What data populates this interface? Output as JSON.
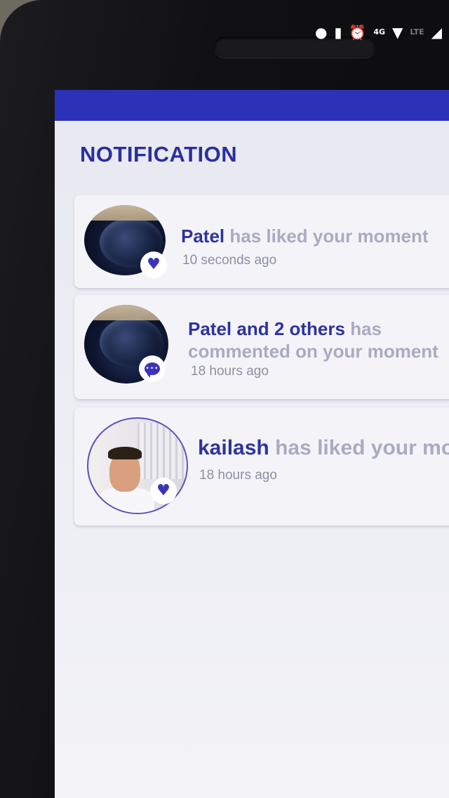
{
  "status_bar": {
    "icons": [
      "location-icon",
      "vibrate-icon",
      "alarm-icon",
      "call-4g-icon",
      "wifi-icon",
      "signal-icon"
    ],
    "network_label": "4G",
    "lte_label": "LTE",
    "color": "#2b32b8"
  },
  "header": {
    "title": "NOTIFICATION",
    "title_color": "#2a2f9e"
  },
  "notifications": [
    {
      "actor": "Patel",
      "action": " has liked your moment",
      "time": "10 seconds ago",
      "badge_icon": "heart-icon"
    },
    {
      "actor": "Patel and 2 others",
      "action": " has commented on your moment",
      "time": "18 hours ago",
      "badge_icon": "comment-icon"
    },
    {
      "actor": "kailash",
      "action": " has liked your moment",
      "time": "18 hours ago",
      "badge_icon": "heart-icon"
    }
  ],
  "colors": {
    "accent": "#3b34b8",
    "muted_text": "#a9abc0",
    "timestamp": "#8d8fa3"
  }
}
